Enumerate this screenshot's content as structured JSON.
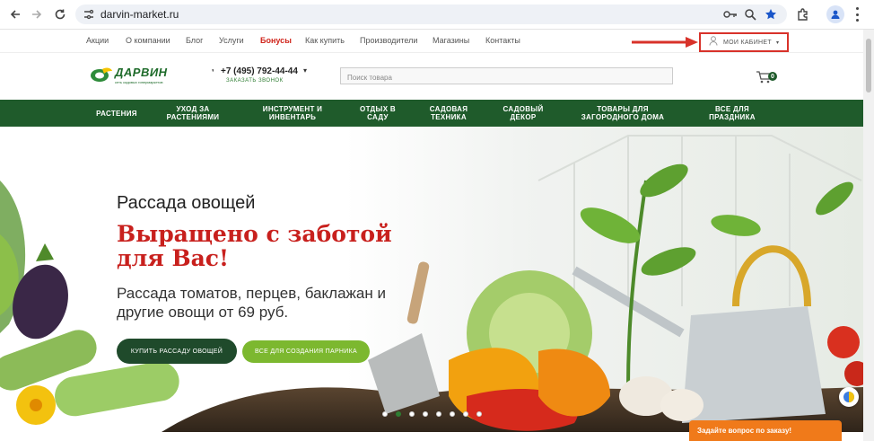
{
  "browser": {
    "url": "darvin-market.ru",
    "icons": [
      "back-icon",
      "forward-icon",
      "reload-icon",
      "site-settings-icon",
      "password-key-icon",
      "zoom-icon",
      "bookmark-star-icon",
      "extensions-icon",
      "profile-icon",
      "menu-icon"
    ]
  },
  "top_nav": {
    "links": [
      "Акции",
      "О компании",
      "Блог",
      "Услуги",
      "Бонусы",
      "Как купить",
      "Производители",
      "Магазины",
      "Контакты"
    ],
    "cabinet_label": "МОИ КАБИНЕТ"
  },
  "header": {
    "logo_name": "ДАРВИН",
    "logo_tagline": "сеть садовых гипермаркетов",
    "phone": "+7 (495) 792-44-44",
    "callback_label": "ЗАКАЗАТЬ ЗВОНОК",
    "search_placeholder": "Поиск товара",
    "cart_count": "0"
  },
  "categories": [
    {
      "line1": "РАСТЕНИЯ",
      "line2": ""
    },
    {
      "line1": "УХОД ЗА",
      "line2": "РАСТЕНИЯМИ"
    },
    {
      "line1": "ИНСТРУМЕНТ И",
      "line2": "ИНВЕНТАРЬ"
    },
    {
      "line1": "ОТДЫХ В",
      "line2": "САДУ"
    },
    {
      "line1": "САДОВАЯ",
      "line2": "ТЕХНИКА"
    },
    {
      "line1": "САДОВЫЙ",
      "line2": "ДЕКОР"
    },
    {
      "line1": "ТОВАРЫ ДЛЯ",
      "line2": "ЗАГОРОДНОГО ДОМА"
    },
    {
      "line1": "ВСЕ ДЛЯ",
      "line2": "ПРАЗДНИКА"
    }
  ],
  "hero": {
    "subtitle": "Рассада овощей",
    "title": "Выращено с заботой для Вас!",
    "text": "Рассада томатов, перцев, баклажан и другие овощи от 69 руб.",
    "button_primary": "КУПИТЬ РАССАДУ ОВОЩЕЙ",
    "button_secondary": "ВСЕ ДЛЯ СОЗДАНИЯ ПАРНИКА",
    "slides_total": 8,
    "active_slide": 2
  },
  "chat": {
    "label": "Задайте вопрос по заказу!"
  },
  "colors": {
    "brand_green": "#1f5b2b",
    "accent_red": "#c8201d",
    "button_light": "#7cb82f",
    "chat_orange": "#f07a1a"
  }
}
